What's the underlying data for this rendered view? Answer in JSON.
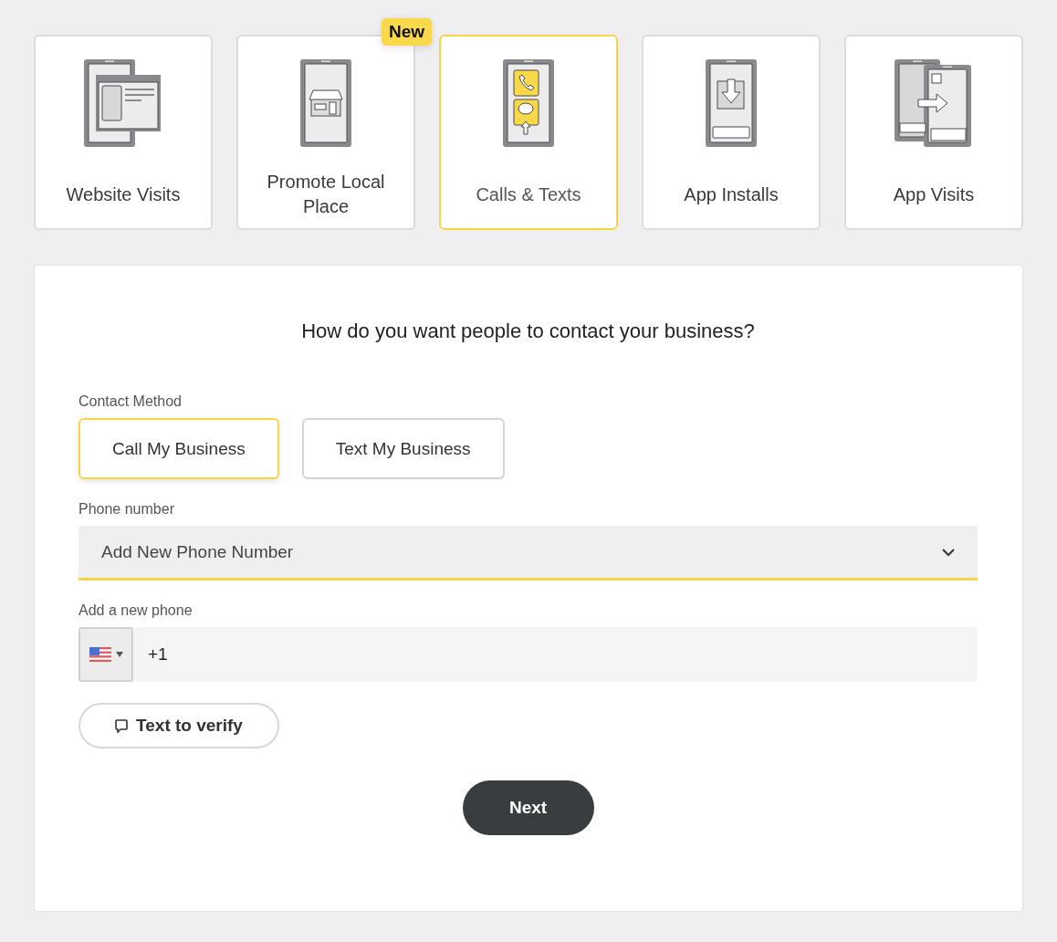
{
  "objectives": [
    {
      "kind": "website",
      "label": "Website Visits",
      "selected": false
    },
    {
      "kind": "store",
      "label": "Promote Local Place",
      "selected": false,
      "badge": "New"
    },
    {
      "kind": "calls",
      "label": "Calls & Texts",
      "selected": true
    },
    {
      "kind": "install",
      "label": "App Installs",
      "selected": false
    },
    {
      "kind": "app",
      "label": "App Visits",
      "selected": false
    }
  ],
  "form": {
    "question": "How do you want people to contact your business?",
    "contact_label": "Contact Method",
    "contact_options": [
      {
        "label": "Call My Business",
        "selected": true
      },
      {
        "label": "Text My Business",
        "selected": false
      }
    ],
    "phone_label": "Phone number",
    "phone_select": {
      "value": "Add New Phone Number"
    },
    "new_phone_label": "Add a new phone",
    "new_phone": {
      "value": "+1"
    },
    "verify_button": "Text to verify",
    "next_button": "Next"
  }
}
